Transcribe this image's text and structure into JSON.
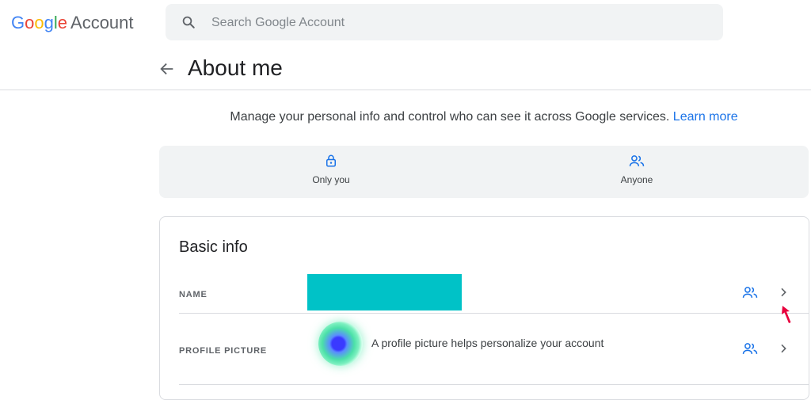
{
  "header": {
    "logo_letters": [
      "G",
      "o",
      "o",
      "g",
      "l",
      "e"
    ],
    "logo_product": "Account",
    "search_placeholder": "Search Google Account"
  },
  "page": {
    "title": "About me",
    "intro": "Manage your personal info and control who can see it across Google services.",
    "learn_more": "Learn more"
  },
  "visibility_legend": {
    "only_you": "Only you",
    "anyone": "Anyone"
  },
  "basic_info": {
    "title": "Basic info",
    "rows": [
      {
        "label": "NAME",
        "value": ""
      },
      {
        "label": "PROFILE PICTURE",
        "value": "A profile picture helps personalize your account"
      }
    ]
  },
  "colors": {
    "accent": "#1a73e8",
    "redaction": "#00c2c7",
    "cursor": "#e8003d"
  },
  "icons": [
    "search-icon",
    "back-arrow-icon",
    "lock-icon",
    "people-icon",
    "chevron-right-icon",
    "mouse-cursor-icon"
  ]
}
